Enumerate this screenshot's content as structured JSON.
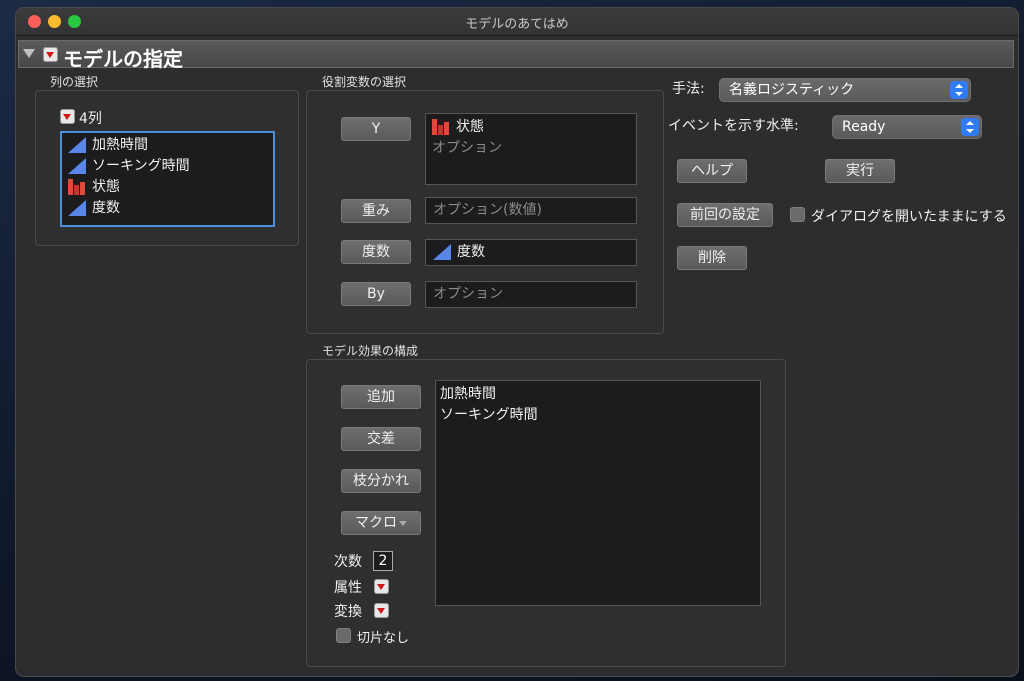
{
  "window": {
    "title": "モデルのあてはめ"
  },
  "section": {
    "title": "モデルの指定"
  },
  "columns": {
    "group_label": "列の選択",
    "count_label": "4列",
    "items": [
      {
        "label": "加熱時間",
        "icon": "continuous-icon"
      },
      {
        "label": "ソーキング時間",
        "icon": "continuous-icon"
      },
      {
        "label": "状態",
        "icon": "nominal-icon"
      },
      {
        "label": "度数",
        "icon": "continuous-icon"
      }
    ]
  },
  "roles": {
    "group_label": "役割変数の選択",
    "y": {
      "button": "Y",
      "value": "状態",
      "placeholder": "オプション"
    },
    "weight": {
      "button": "重み",
      "placeholder": "オプション(数値)"
    },
    "freq": {
      "button": "度数",
      "value": "度数"
    },
    "by": {
      "button": "By",
      "placeholder": "オプション"
    }
  },
  "options": {
    "method_label": "手法:",
    "method_value": "名義ロジスティック",
    "event_label": "イベントを示す水準:",
    "event_value": "Ready",
    "help_button": "ヘルプ",
    "run_button": "実行",
    "recall_button": "前回の設定",
    "keep_open_label": "ダイアログを開いたままにする",
    "keep_open_checked": false,
    "remove_button": "削除"
  },
  "effects": {
    "group_label": "モデル効果の構成",
    "add_button": "追加",
    "cross_button": "交差",
    "nest_button": "枝分かれ",
    "macros_button": "マクロ",
    "degree_label": "次数",
    "degree_value": "2",
    "attributes_label": "属性",
    "transform_label": "変換",
    "no_intercept_label": "切片なし",
    "no_intercept_checked": false,
    "items": [
      "加熱時間",
      "ソーキング時間"
    ]
  }
}
